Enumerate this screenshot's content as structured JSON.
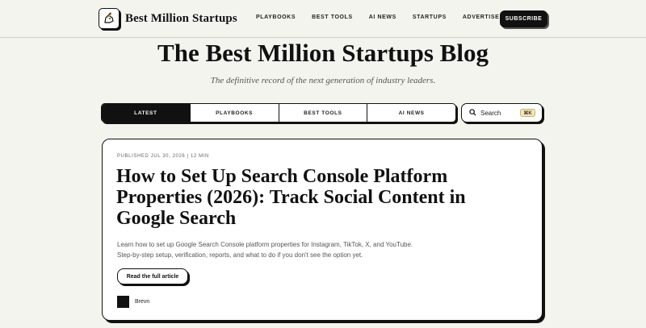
{
  "header": {
    "brand_name": "Best Million Startups",
    "nav": [
      "PLAYBOOKS",
      "BEST TOOLS",
      "AI NEWS",
      "STARTUPS",
      "ADVERTISE"
    ],
    "subscribe_label": "SUBSCRIBE"
  },
  "hero": {
    "title": "The Best Million Startups Blog",
    "subtitle": "The definitive record of the next generation of industry leaders."
  },
  "tabs": {
    "items": [
      "LATEST",
      "PLAYBOOKS",
      "BEST TOOLS",
      "AI NEWS"
    ],
    "active": "LATEST"
  },
  "search": {
    "label": "Search",
    "shortcut": "⌘K"
  },
  "article": {
    "meta": "PUBLISHED JUL 30, 2026 | 12 MIN",
    "title": "How to Set Up Search Console Platform Properties (2026): Track Social Content in Google Search",
    "excerpt_line1": "Learn how to set up Google Search Console platform properties for Instagram, TikTok, X, and YouTube.",
    "excerpt_line2": "Step-by-step setup, verification, reports, and what to do if you don't see the option yet.",
    "cta_label": "Read the full article",
    "author": "Brevn"
  },
  "colors": {
    "background": "#f4f4ef",
    "ink": "#111111",
    "shortcut_badge": "#f5e6b8"
  }
}
